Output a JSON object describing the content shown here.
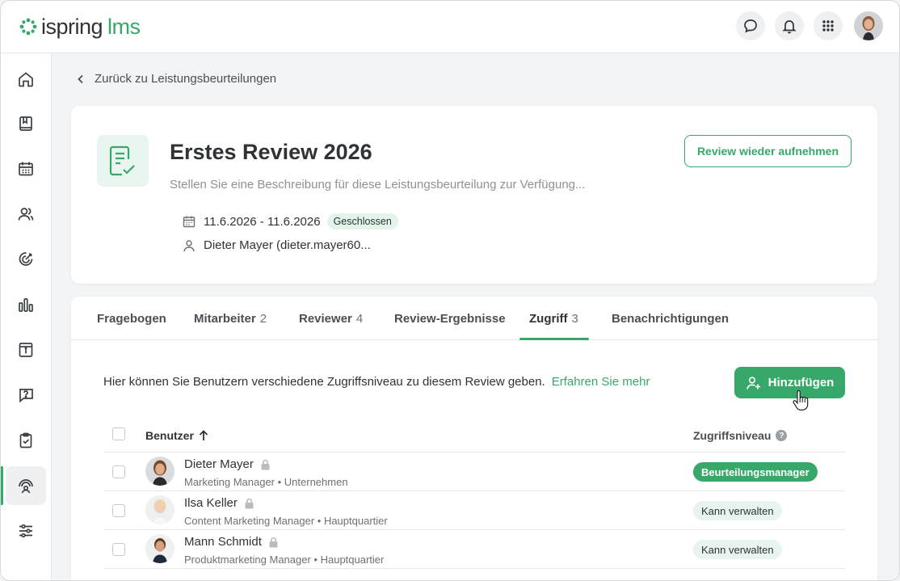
{
  "brand": {
    "name": "ispring",
    "product": "lms",
    "accent": "#38a86a"
  },
  "topbar": {
    "icons": [
      "chat-icon",
      "bell-icon",
      "apps-grid-icon"
    ],
    "avatar": "user-avatar"
  },
  "sidebar": {
    "items": [
      {
        "icon": "home-icon"
      },
      {
        "icon": "book-icon"
      },
      {
        "icon": "calendar-icon"
      },
      {
        "icon": "users-icon"
      },
      {
        "icon": "target-icon"
      },
      {
        "icon": "chart-icon"
      },
      {
        "icon": "info-box-icon"
      },
      {
        "icon": "question-chat-icon"
      },
      {
        "icon": "clipboard-check-icon"
      },
      {
        "icon": "performance-review-icon",
        "active": true
      },
      {
        "icon": "sliders-icon"
      }
    ]
  },
  "back_link": {
    "label": "Zurück zu Leistungsbeurteilungen"
  },
  "review": {
    "title": "Erstes Review 2026",
    "description": "Stellen Sie eine Beschreibung für diese Leistungsbeurteilung zur Verfügung...",
    "resume_button": "Review wieder aufnehmen",
    "date_range": "11.6.2026 - 11.6.2026",
    "status": "Geschlossen",
    "owner": "Dieter Mayer (dieter.mayer60..."
  },
  "tabs": [
    {
      "label": "Fragebogen",
      "count": ""
    },
    {
      "label": "Mitarbeiter",
      "count": "2"
    },
    {
      "label": "Reviewer",
      "count": "4"
    },
    {
      "label": "Review-Ergebnisse",
      "count": ""
    },
    {
      "label": "Zugriff",
      "count": "3",
      "active": true
    },
    {
      "label": "Benachrichtigungen",
      "count": ""
    }
  ],
  "access": {
    "info": "Hier können Sie Benutzern verschiedene Zugriffsniveau zu diesem Review geben.",
    "learn_more": "Erfahren Sie mehr",
    "add_button": "Hinzufügen",
    "columns": {
      "user": "Benutzer",
      "level": "Zugriffsniveau"
    },
    "rows": [
      {
        "name": "Dieter Mayer",
        "role": "Marketing Manager",
        "unit": "Unternehmen",
        "level": "Beurteilungsmanager",
        "level_style": "primary"
      },
      {
        "name": "Ilsa Keller",
        "role": "Content Marketing Manager",
        "unit": "Hauptquartier",
        "level": "Kann verwalten",
        "level_style": "secondary"
      },
      {
        "name": "Mann Schmidt",
        "role": "Produktmarketing Manager",
        "unit": "Hauptquartier",
        "level": "Kann verwalten",
        "level_style": "secondary"
      }
    ]
  }
}
